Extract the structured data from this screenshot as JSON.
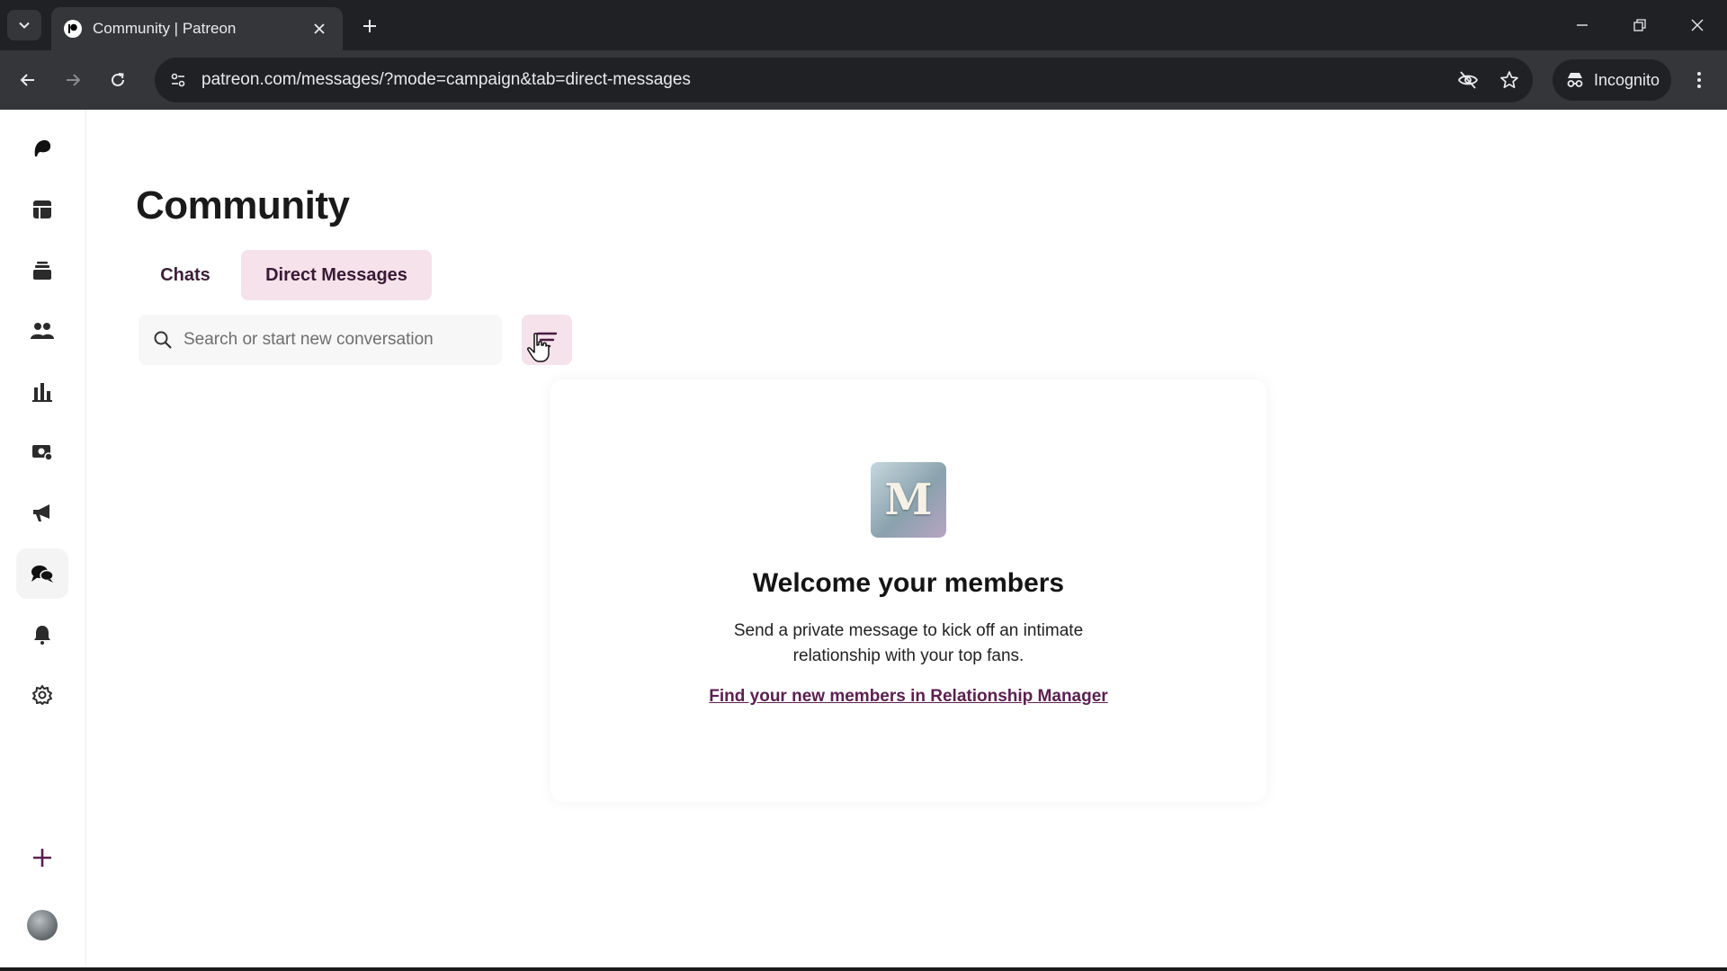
{
  "browser": {
    "tab_title": "Community | Patreon",
    "url": "patreon.com/messages/?mode=campaign&tab=direct-messages",
    "incognito_label": "Incognito"
  },
  "sidebar": {
    "items": [
      {
        "icon": "patreon-logo-icon"
      },
      {
        "icon": "dashboard-icon"
      },
      {
        "icon": "library-icon"
      },
      {
        "icon": "audience-icon"
      },
      {
        "icon": "insights-icon"
      },
      {
        "icon": "payouts-icon"
      },
      {
        "icon": "promotions-icon"
      },
      {
        "icon": "chat-icon",
        "active": true
      },
      {
        "icon": "notifications-icon"
      },
      {
        "icon": "settings-icon"
      },
      {
        "icon": "create-plus-icon"
      }
    ]
  },
  "page": {
    "title": "Community",
    "tabs": [
      {
        "label": "Chats",
        "active": false
      },
      {
        "label": "Direct Messages",
        "active": true
      }
    ],
    "search": {
      "placeholder": "Search or start new conversation"
    },
    "empty_state": {
      "image_letter": "M",
      "title": "Welcome your members",
      "text": "Send a private message to kick off an intimate relationship with your top fans.",
      "link": "Find your new members in Relationship Manager"
    }
  },
  "colors": {
    "accent_bg": "#f5e2ea",
    "accent_text": "#5b2050",
    "chrome_dark": "#202124",
    "chrome_toolbar": "#35363a"
  }
}
